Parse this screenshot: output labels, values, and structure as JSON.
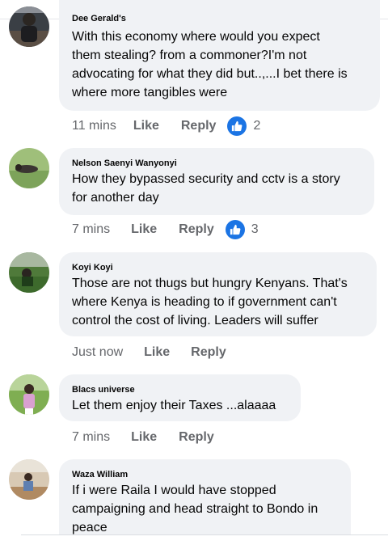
{
  "comments": [
    {
      "author": "Dee Gerald's",
      "lines": [
        "With this economy where would you expect",
        "them stealing? from a commoner?I'm not",
        "advocating for what they did but..,...I bet there is",
        "where more tangibles were"
      ],
      "time": "11 mins",
      "like_label": "Like",
      "reply_label": "Reply",
      "reaction_icon": "like-icon",
      "reaction_count": "2"
    },
    {
      "author": "Nelson Saenyi Wanyonyi",
      "lines": [
        "How they bypassed security and cctv is a story",
        "for another day"
      ],
      "time": "7 mins",
      "like_label": "Like",
      "reply_label": "Reply",
      "reaction_icon": "like-icon",
      "reaction_count": "3"
    },
    {
      "author": "Koyi Koyi",
      "lines": [
        "Those are not thugs but hungry Kenyans. That's",
        "where Kenya is heading to if government can't",
        "control the cost of living. Leaders will suffer"
      ],
      "time": "Just now",
      "like_label": "Like",
      "reply_label": "Reply"
    },
    {
      "author": "Blacs universe",
      "lines": [
        "Let them enjoy their Taxes ...alaaaa"
      ],
      "time": "7 mins",
      "like_label": "Like",
      "reply_label": "Reply"
    },
    {
      "author": "Waza William",
      "lines": [
        "If i were Raila I would have stopped",
        "campaigning and head straight to Bondo in",
        "peace"
      ]
    }
  ],
  "colors": {
    "bubble_bg": "#f0f2f5",
    "meta_text": "#65676b",
    "like_blue": "#1b74e4"
  }
}
